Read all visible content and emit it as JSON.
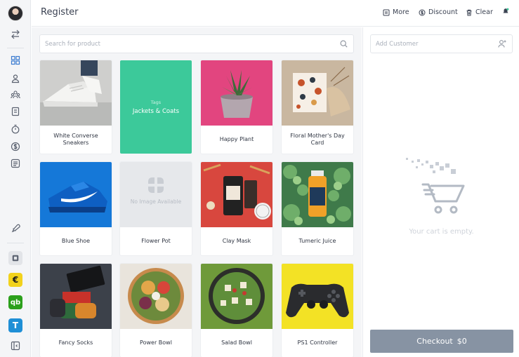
{
  "header": {
    "title": "Register",
    "actions": {
      "more": "More",
      "discount": "Discount",
      "clear": "Clear"
    }
  },
  "search": {
    "placeholder": "Search for product"
  },
  "products": [
    {
      "name": "White Converse Sneakers"
    },
    {
      "tag_kicker": "Tags",
      "name": "Jackets & Coats"
    },
    {
      "name": "Happy Plant"
    },
    {
      "name": "Floral Mother's Day Card"
    },
    {
      "name": "Blue Shoe"
    },
    {
      "name": "Flower Pot",
      "placeholder_text": "No Image Available"
    },
    {
      "name": "Clay Mask"
    },
    {
      "name": "Tumeric Juice"
    },
    {
      "name": "Fancy Socks"
    },
    {
      "name": "Power Bowl"
    },
    {
      "name": "Salad Bowl"
    },
    {
      "name": "PS1 Controller"
    }
  ],
  "cart": {
    "customer_placeholder": "Add Customer",
    "empty_text": "Your cart is empty.",
    "checkout_label": "Checkout",
    "checkout_total": "$0"
  },
  "sidebar": {
    "icons": [
      "avatar",
      "swap-icon",
      "register-icon",
      "customers-icon",
      "groups-icon",
      "orders-icon",
      "timer-icon",
      "dollar-icon",
      "cash-register-icon",
      "rocket-icon",
      "app-gray-icon",
      "app-euro-icon",
      "app-quickbooks-icon",
      "app-t-icon",
      "collapse-sidebar-icon"
    ],
    "apps": {
      "euro": "€",
      "quickbooks": "qb",
      "t": "T"
    }
  },
  "colors": {
    "accent_green": "#3cc99a",
    "checkout_gray": "#8793a3",
    "sidebar_bg": "#f4f5f7"
  }
}
